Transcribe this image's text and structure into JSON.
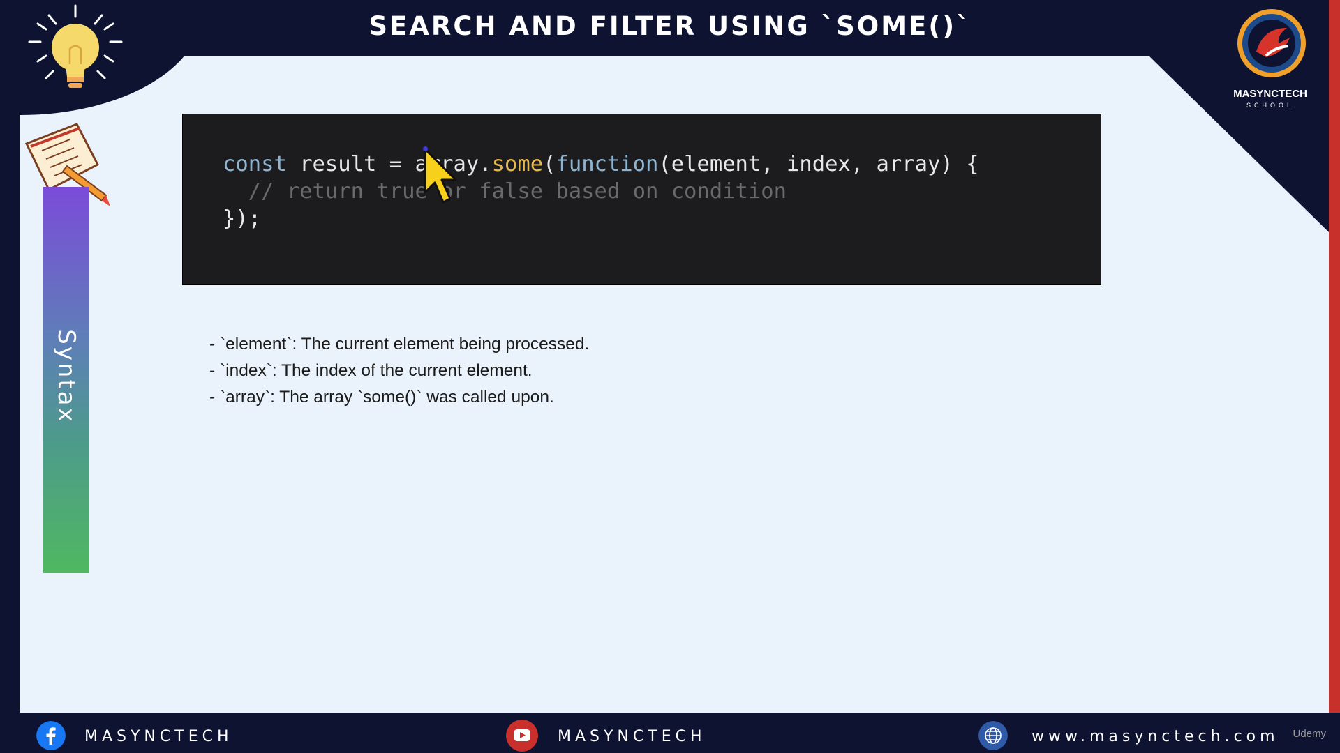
{
  "header": {
    "title": "SEARCH AND FILTER USING `SOME()`"
  },
  "logo": {
    "name": "MASYNCTECH",
    "sub": "SCHOOL"
  },
  "sidebar": {
    "section_label": "Syntax"
  },
  "code": {
    "line1": {
      "kw": "const",
      "mid": " result = array.",
      "fn": "some",
      "open": "(",
      "kw2": "function",
      "rest": "(element, index, array) {"
    },
    "line2": "  // return true or false based on condition",
    "line3": "});"
  },
  "bullets": [
    "- `element`: The current element being processed.",
    "- `index`: The index of the current element.",
    "- `array`: The array `some()` was called upon."
  ],
  "footer": {
    "facebook": "MASYNCTECH",
    "youtube": "MASYNCTECH",
    "website": "www.masynctech.com",
    "watermark": "Udemy"
  },
  "colors": {
    "background": "#0d1330",
    "slide": "#eaf2fb",
    "accent": "#c8302c",
    "code_bg": "#1c1c1e"
  },
  "icons": [
    "lightbulb-icon",
    "notebook-pen-icon",
    "facebook-icon",
    "youtube-icon",
    "globe-icon",
    "cursor-icon"
  ]
}
